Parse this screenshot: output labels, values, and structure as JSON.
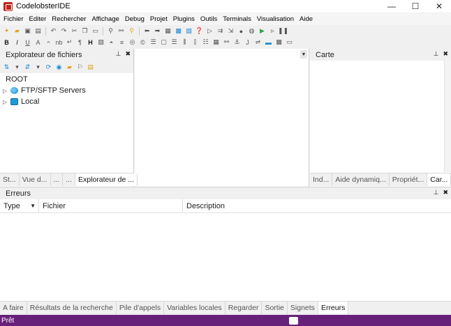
{
  "window": {
    "title": "CodelobsterIDE",
    "minimize": "—",
    "maximize": "☐",
    "close": "✕"
  },
  "menu": [
    "Fichier",
    "Editer",
    "Rechercher",
    "Affichage",
    "Debug",
    "Projet",
    "Plugins",
    "Outils",
    "Terminals",
    "Visualisation",
    "Aide"
  ],
  "explorer": {
    "title": "Explorateur de fichiers",
    "root": "ROOT",
    "nodes": [
      {
        "label": "FTP/SFTP Servers",
        "icon": "globe-icon"
      },
      {
        "label": "Local",
        "icon": "drive-icon"
      }
    ],
    "tabs": [
      "St...",
      "Vue d...",
      "...",
      "...",
      "Explorateur de ..."
    ]
  },
  "carte": {
    "title": "Carte",
    "tabs": [
      "Ind...",
      "Aide dynamiq...",
      "Propriét...",
      "Car..."
    ]
  },
  "errors": {
    "title": "Erreurs",
    "columns": [
      "Type",
      "Fichier",
      "Description"
    ]
  },
  "bottom_tabs": [
    "A faire",
    "Résultats de la recherche",
    "Pile d'appels",
    "Variables locales",
    "Regarder",
    "Sortie",
    "Signets",
    "Erreurs"
  ],
  "status": {
    "text": "Prêt",
    "accent": "#68217a"
  },
  "panel_controls": {
    "pin": "📌",
    "close": "✖"
  }
}
